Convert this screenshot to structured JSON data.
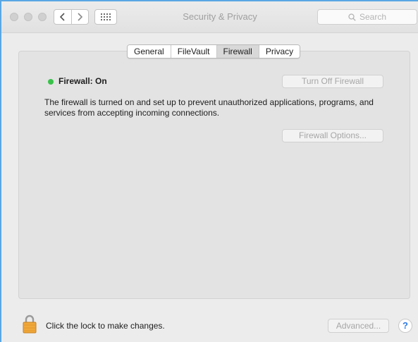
{
  "window": {
    "title": "Security & Privacy",
    "search_placeholder": "Search"
  },
  "tabs": [
    {
      "label": "General",
      "selected": false
    },
    {
      "label": "FileVault",
      "selected": false
    },
    {
      "label": "Firewall",
      "selected": true
    },
    {
      "label": "Privacy",
      "selected": false
    }
  ],
  "firewall": {
    "status_label": "Firewall: On",
    "status_color": "#39c24a",
    "turn_off_label": "Turn Off Firewall",
    "description": "The firewall is turned on and set up to prevent unauthorized applications, programs, and services from accepting incoming connections.",
    "options_label": "Firewall Options..."
  },
  "footer": {
    "lock_text": "Click the lock to make changes.",
    "advanced_label": "Advanced...",
    "help_label": "?"
  },
  "icons": {
    "back": "chevron-left-icon",
    "forward": "chevron-right-icon",
    "show_all": "grid-icon",
    "search": "search-icon",
    "lock": "lock-icon"
  }
}
